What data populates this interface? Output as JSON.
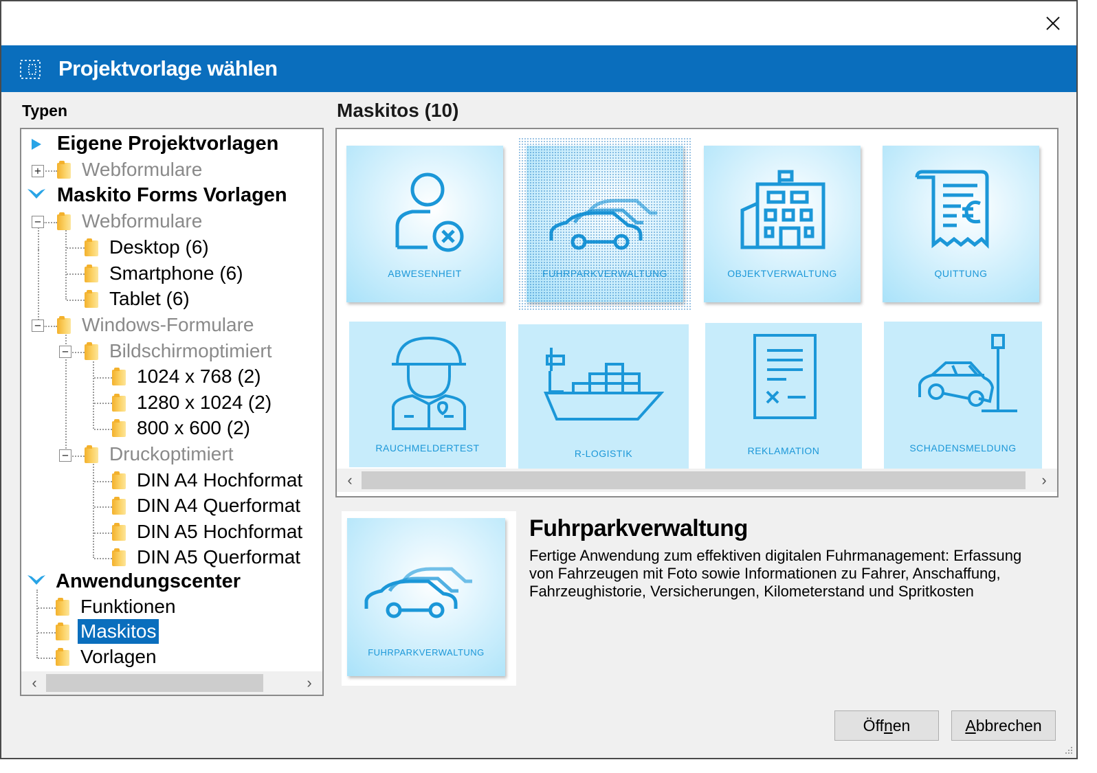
{
  "window": {
    "title": "Projektvorlage wählen",
    "close_icon": "close-icon"
  },
  "left": {
    "heading": "Typen",
    "tree": {
      "eigene": "Eigene Projektvorlagen",
      "eigene_web": "Webformulare",
      "maskito": "Maskito Forms Vorlagen",
      "maskito_web": "Webformulare",
      "desktop": "Desktop (6)",
      "smartphone": "Smartphone (6)",
      "tablet": "Tablet (6)",
      "windows": "Windows-Formulare",
      "bildschirm": "Bildschirmoptimiert",
      "r1024": "1024 x 768 (2)",
      "r1280": "1280 x 1024 (2)",
      "r800": "800 x 600 (2)",
      "druck": "Druckoptimiert",
      "a4h": "DIN A4 Hochformat",
      "a4q": "DIN A4 Querformat",
      "a5h": "DIN A5 Hochformat",
      "a5q": "DIN A5 Querformat",
      "center": "Anwendungscenter",
      "funktionen": "Funktionen",
      "maskitos": "Maskitos",
      "vorlagen": "Vorlagen"
    }
  },
  "gallery": {
    "heading": "Maskitos (10)",
    "tiles": [
      {
        "label": "ABWESENHEIT",
        "icon": "person-absence-icon"
      },
      {
        "label": "FUHRPARKVERWALTUNG",
        "icon": "fleet-cars-icon",
        "selected": true
      },
      {
        "label": "OBJEKTVERWALTUNG",
        "icon": "building-icon"
      },
      {
        "label": "QUITTUNG",
        "icon": "receipt-euro-icon"
      },
      {
        "label": "RAUCHMELDERTEST",
        "icon": "firefighter-icon"
      },
      {
        "label": "R-LOGISTIK",
        "icon": "cargo-ship-icon"
      },
      {
        "label": "REKLAMATION",
        "icon": "document-reject-icon"
      },
      {
        "label": "SCHADENSMELDUNG",
        "icon": "car-crash-icon"
      }
    ]
  },
  "detail": {
    "tile_label": "FUHRPARKVERWALTUNG",
    "title": "Fuhrparkverwaltung",
    "description": "Fertige Anwendung zum effektiven digitalen Fuhrmanagement: Erfassung von Fahrzeugen mit Foto sowie Informationen zu Fahrer, Anschaffung, Fahrzeughistorie, Versicherungen, Kilometerstand und Spritkosten"
  },
  "buttons": {
    "open_pre": "Ö",
    "open_mid": "ff",
    "open_u": "n",
    "open_post": "en",
    "cancel_u": "A",
    "cancel_post": "bbrechen"
  },
  "colors": {
    "accent": "#0a6ebd",
    "icon": "#1b97d8",
    "folder": "#f3b12c"
  }
}
